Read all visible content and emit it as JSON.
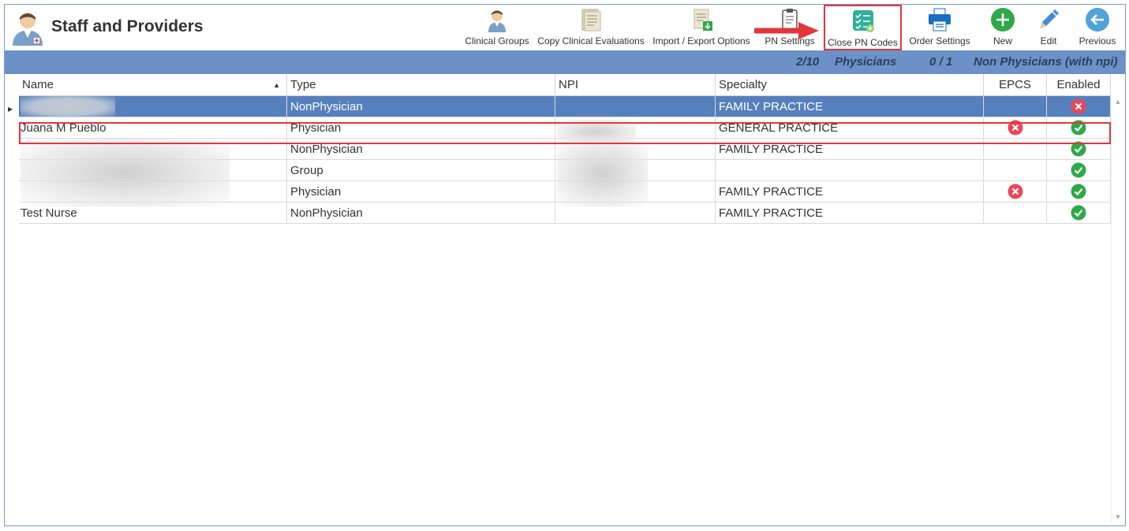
{
  "app": {
    "title": "Staff and Providers",
    "icon": "doctor-icon"
  },
  "toolbar": [
    {
      "label": "Clinical Groups",
      "icon": "clinical-groups-icon"
    },
    {
      "label": "Copy Clinical Evaluations",
      "icon": "copy-document-icon"
    },
    {
      "label": "Import / Export Options",
      "icon": "import-export-icon"
    },
    {
      "label": "PN Settings",
      "icon": "clipboard-icon"
    },
    {
      "label": "Close PN Codes",
      "icon": "checklist-icon"
    },
    {
      "label": "Order Settings",
      "icon": "printer-icon"
    },
    {
      "label": "New",
      "icon": "plus-icon"
    },
    {
      "label": "Edit",
      "icon": "pencil-icon"
    },
    {
      "label": "Previous",
      "icon": "back-arrow-icon"
    }
  ],
  "stats": {
    "physicians_count": "2/10",
    "physicians_label": "Physicians",
    "nonphysicians_count": "0 / 1",
    "nonphysicians_label": "Non Physicians (with npi)"
  },
  "columns": [
    "Name",
    "Type",
    "NPI",
    "Specialty",
    "EPCS",
    "Enabled"
  ],
  "rows": [
    {
      "name": "",
      "type": "NonPhysician",
      "npi": "",
      "specialty": "FAMILY PRACTICE",
      "epcs": "",
      "enabled": "x"
    },
    {
      "name": "Juana M Pueblo",
      "type": "Physician",
      "npi": "",
      "specialty": "GENERAL PRACTICE",
      "epcs": "x",
      "enabled": "check"
    },
    {
      "name": "",
      "type": "NonPhysician",
      "npi": "",
      "specialty": "FAMILY PRACTICE",
      "epcs": "",
      "enabled": "check"
    },
    {
      "name": "",
      "type": "Group",
      "npi": "",
      "specialty": "",
      "epcs": "",
      "enabled": "check"
    },
    {
      "name": "",
      "type": "Physician",
      "npi": "",
      "specialty": "FAMILY PRACTICE",
      "epcs": "x",
      "enabled": "check"
    },
    {
      "name": "Test Nurse",
      "type": "NonPhysician",
      "npi": "",
      "specialty": "FAMILY PRACTICE",
      "epcs": "",
      "enabled": "check"
    }
  ],
  "colors": {
    "accent": "#6b91c6",
    "selected_row": "#5680bd",
    "highlight": "#e2363d",
    "ok": "#2ea84a",
    "error": "#e8485a"
  }
}
